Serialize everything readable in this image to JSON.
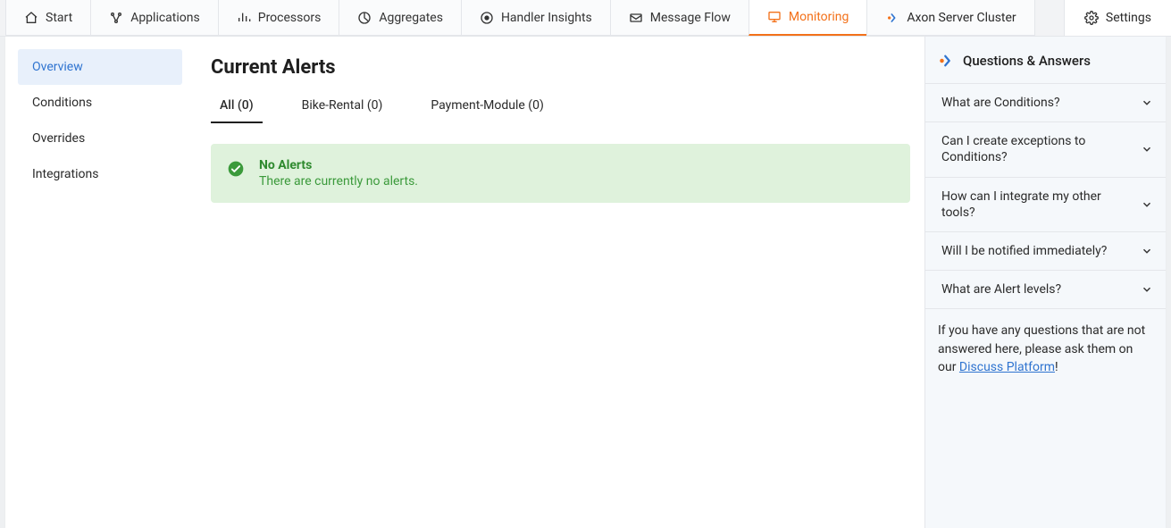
{
  "topnav": {
    "items": [
      {
        "label": "Start",
        "icon": "home-icon"
      },
      {
        "label": "Applications",
        "icon": "apps-icon"
      },
      {
        "label": "Processors",
        "icon": "processors-icon"
      },
      {
        "label": "Aggregates",
        "icon": "aggregates-icon"
      },
      {
        "label": "Handler Insights",
        "icon": "insights-icon"
      },
      {
        "label": "Message Flow",
        "icon": "mail-icon"
      },
      {
        "label": "Monitoring",
        "icon": "monitor-icon",
        "active": true
      },
      {
        "label": "Axon Server Cluster",
        "icon": "axon-icon"
      }
    ],
    "settings_label": "Settings"
  },
  "sidebar": {
    "items": [
      {
        "label": "Overview",
        "active": true
      },
      {
        "label": "Conditions"
      },
      {
        "label": "Overrides"
      },
      {
        "label": "Integrations"
      }
    ]
  },
  "page": {
    "title": "Current Alerts"
  },
  "tabs": [
    {
      "label": "All (0)",
      "active": true
    },
    {
      "label": "Bike-Rental (0)"
    },
    {
      "label": "Payment-Module (0)"
    }
  ],
  "alert": {
    "title": "No Alerts",
    "subtitle": "There are currently no alerts."
  },
  "qa": {
    "title": "Questions & Answers",
    "items": [
      {
        "label": "What are Conditions?"
      },
      {
        "label": "Can I create exceptions to Conditions?"
      },
      {
        "label": "How can I integrate my other tools?"
      },
      {
        "label": "Will I be notified immediately?"
      },
      {
        "label": "What are Alert levels?"
      }
    ],
    "footer_pre": "If you have any questions that are not answered here, please ask them on our ",
    "footer_link": "Discuss Platform",
    "footer_post": "!"
  }
}
